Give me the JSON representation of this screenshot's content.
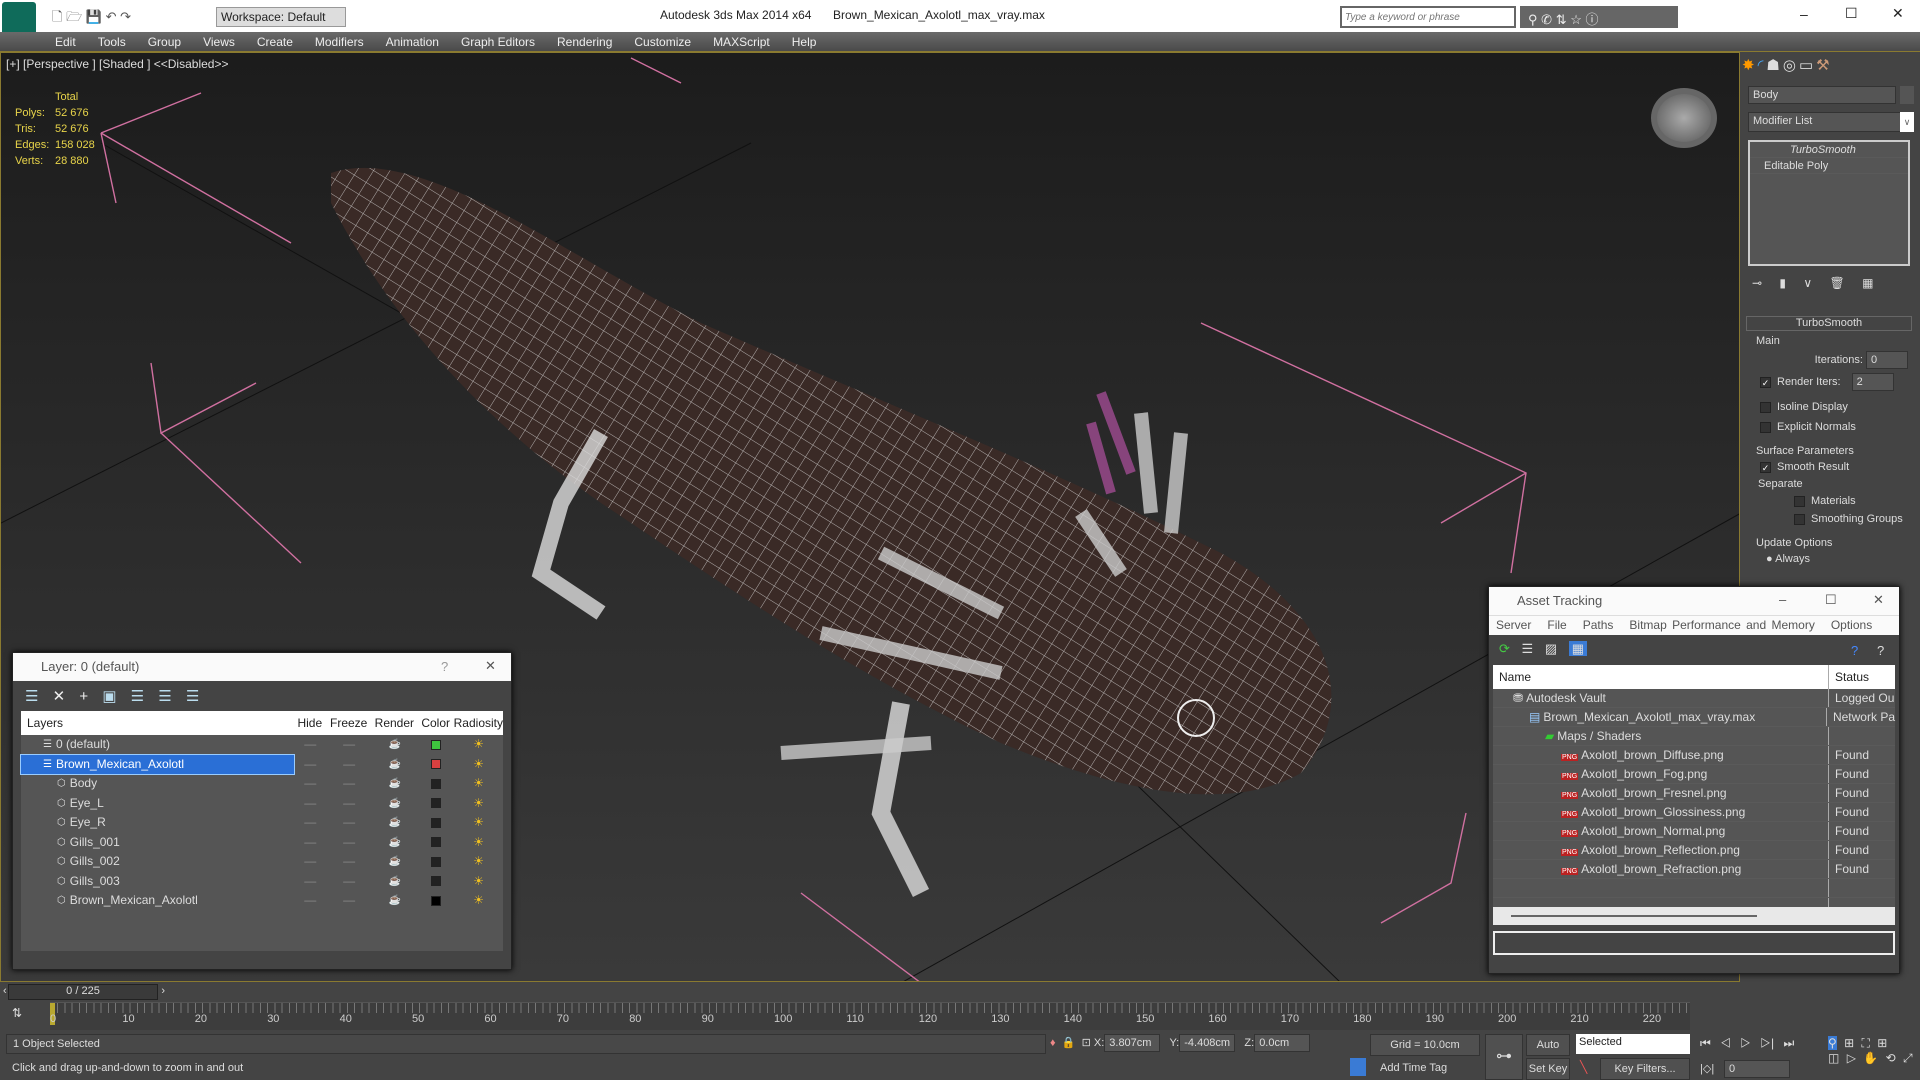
{
  "titlebar": {
    "app": "Autodesk 3ds Max  2014 x64",
    "file": "Brown_Mexican_Axolotl_max_vray.max",
    "workspace": "Workspace: Default",
    "search_placeholder": "Type a keyword or phrase"
  },
  "menu": [
    "Edit",
    "Tools",
    "Group",
    "Views",
    "Create",
    "Modifiers",
    "Animation",
    "Graph Editors",
    "Rendering",
    "Customize",
    "MAXScript",
    "Help"
  ],
  "viewport": {
    "label": "[+] [Perspective ] [Shaded ]  <<Disabled>>",
    "stats": {
      "header": "Total",
      "rows": [
        {
          "k": "Polys:",
          "v": "52 676"
        },
        {
          "k": "Tris:",
          "v": "52 676"
        },
        {
          "k": "Edges:",
          "v": "158 028"
        },
        {
          "k": "Verts:",
          "v": "28 880"
        }
      ]
    }
  },
  "command_panel": {
    "object_name": "Body",
    "modifier_list": "Modifier List",
    "stack": [
      "TurboSmooth",
      "Editable Poly"
    ],
    "rollout": "TurboSmooth",
    "main": "Main",
    "iterations_label": "Iterations:",
    "iterations": "0",
    "render_iters_label": "Render Iters:",
    "render_iters": "2",
    "isoline": "Isoline Display",
    "explicit_normals": "Explicit Normals",
    "surface_params": "Surface Parameters",
    "smooth_result": "Smooth Result",
    "separate": "Separate",
    "materials": "Materials",
    "smoothing_groups": "Smoothing Groups",
    "update_options": "Update Options",
    "always": "Always"
  },
  "layer_dialog": {
    "title": "Layer: 0 (default)",
    "help": "?",
    "columns": [
      "Layers",
      "Hide",
      "Freeze",
      "Render",
      "Color",
      "Radiosity"
    ],
    "rows": [
      {
        "name": "0 (default)",
        "color": "#3ec43e",
        "indent": 1
      },
      {
        "name": "Brown_Mexican_Axolotl",
        "color": "#d84040",
        "indent": 1,
        "selected": true
      },
      {
        "name": "Body",
        "color": "#222222",
        "indent": 2
      },
      {
        "name": "Eye_L",
        "color": "#222222",
        "indent": 2
      },
      {
        "name": "Eye_R",
        "color": "#222222",
        "indent": 2
      },
      {
        "name": "Gills_001",
        "color": "#222222",
        "indent": 2
      },
      {
        "name": "Gills_002",
        "color": "#222222",
        "indent": 2
      },
      {
        "name": "Gills_003",
        "color": "#222222",
        "indent": 2
      },
      {
        "name": "Brown_Mexican_Axolotl",
        "color": "#000000",
        "indent": 2
      }
    ]
  },
  "asset_tracking": {
    "title": "Asset Tracking",
    "menu": [
      "Server",
      "File",
      "Paths",
      "Bitmap Performance and Memory",
      "Options"
    ],
    "columns": [
      "Name",
      "Status"
    ],
    "rows": [
      {
        "name": "Autodesk Vault",
        "status": "Logged Ou",
        "indent": 1
      },
      {
        "name": "Brown_Mexican_Axolotl_max_vray.max",
        "status": "Network Pa",
        "indent": 2
      },
      {
        "name": "Maps / Shaders",
        "status": "",
        "indent": 3
      },
      {
        "name": "Axolotl_brown_Diffuse.png",
        "status": "Found",
        "indent": 4
      },
      {
        "name": "Axolotl_brown_Fog.png",
        "status": "Found",
        "indent": 4
      },
      {
        "name": "Axolotl_brown_Fresnel.png",
        "status": "Found",
        "indent": 4
      },
      {
        "name": "Axolotl_brown_Glossiness.png",
        "status": "Found",
        "indent": 4
      },
      {
        "name": "Axolotl_brown_Normal.png",
        "status": "Found",
        "indent": 4
      },
      {
        "name": "Axolotl_brown_Reflection.png",
        "status": "Found",
        "indent": 4
      },
      {
        "name": "Axolotl_brown_Refraction.png",
        "status": "Found",
        "indent": 4
      }
    ]
  },
  "timeline": {
    "frame": "0 / 225",
    "ticks": [
      "0",
      "10",
      "20",
      "30",
      "40",
      "50",
      "60",
      "70",
      "80",
      "90",
      "100",
      "110",
      "120",
      "130",
      "140",
      "150",
      "160",
      "170",
      "180",
      "190",
      "200",
      "210",
      "220"
    ]
  },
  "status": {
    "selected": "1 Object Selected",
    "prompt": "Click and drag up-and-down to zoom in and out",
    "x_label": "X:",
    "x": "3.807cm",
    "y_label": "Y:",
    "y": "-4.408cm",
    "z_label": "Z:",
    "z": "0.0cm",
    "grid": "Grid = 10.0cm",
    "add_time_tag": "Add Time Tag",
    "auto_key": "Auto Key",
    "set_key": "Set Key",
    "key_mode": "Selected",
    "key_filters": "Key Filters...",
    "current_frame": "0"
  }
}
